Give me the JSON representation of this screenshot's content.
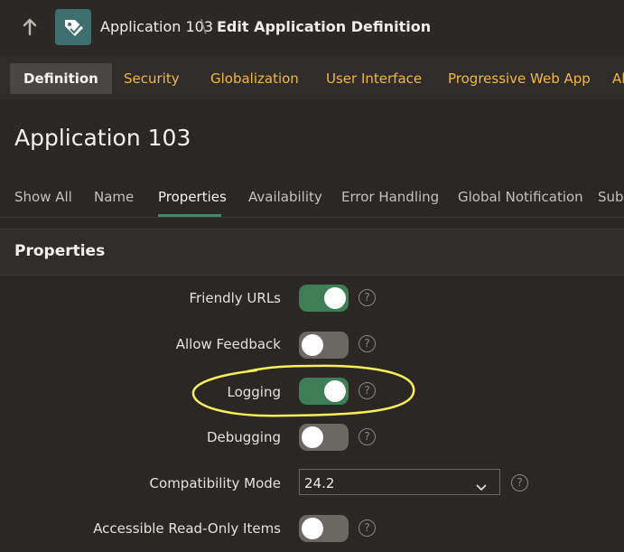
{
  "header": {
    "app_name": "Application 103",
    "separator": "\\",
    "page_name": "Edit Application Definition"
  },
  "top_tabs": [
    {
      "label": "Definition",
      "active": true
    },
    {
      "label": "Security"
    },
    {
      "label": "Globalization"
    },
    {
      "label": "User Interface"
    },
    {
      "label": "Progressive Web App"
    },
    {
      "label": "Al"
    }
  ],
  "page_title": "Application 103",
  "sub_tabs": [
    {
      "label": "Show All"
    },
    {
      "label": "Name"
    },
    {
      "label": "Properties",
      "active": true
    },
    {
      "label": "Availability"
    },
    {
      "label": "Error Handling"
    },
    {
      "label": "Global Notification"
    },
    {
      "label": "Subs"
    }
  ],
  "section": {
    "title": "Properties"
  },
  "fields": {
    "friendly_urls": {
      "label": "Friendly URLs",
      "on": true
    },
    "allow_feedback": {
      "label": "Allow Feedback",
      "on": false
    },
    "logging": {
      "label": "Logging",
      "on": true
    },
    "debugging": {
      "label": "Debugging",
      "on": false
    },
    "compatibility_mode": {
      "label": "Compatibility Mode",
      "value": "24.2"
    },
    "accessible_read_only": {
      "label": "Accessible Read-Only Items",
      "on": false
    }
  },
  "help_glyph": "?",
  "colors": {
    "accent_tab": "#f0b93c",
    "toggle_on": "#3e7d55",
    "toggle_off": "#6b6763",
    "annotation": "#f5f05a"
  },
  "icons": {
    "back": "up-arrow-icon",
    "app": "app-tag-icon",
    "help": "help-icon",
    "select": "chevron-down-icon"
  }
}
